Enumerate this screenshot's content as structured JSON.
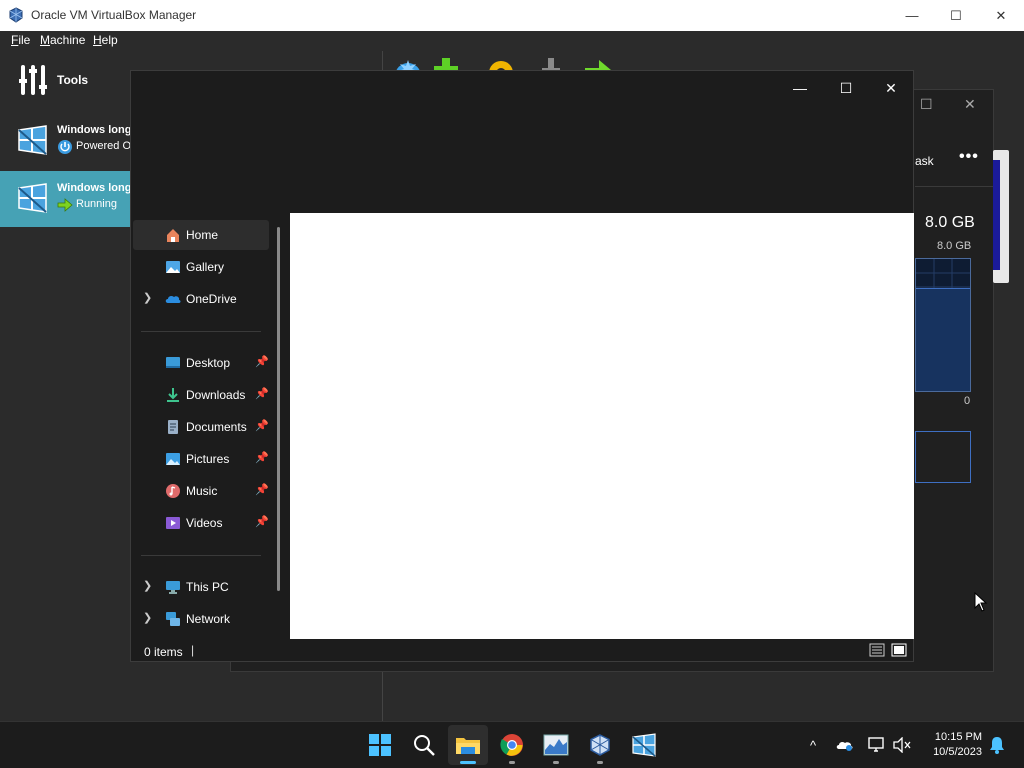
{
  "vbox": {
    "title": "Oracle VM VirtualBox Manager",
    "menu": [
      "File",
      "Machine",
      "Help"
    ],
    "tools_label": "Tools",
    "vms": [
      {
        "name": "Windows long",
        "state": "Powered O",
        "selected": false
      },
      {
        "name": "Windows long",
        "state": "Running",
        "selected": true
      }
    ]
  },
  "taskmgr": {
    "task_label": "ask",
    "more_label": "•••",
    "memory_total": "8.0 GB",
    "memory_axis_max": "8.0 GB",
    "memory_axis_min": "0",
    "memory_used_fraction": 0.78
  },
  "explorer": {
    "nav": {
      "home": "Home",
      "gallery": "Gallery",
      "onedrive": "OneDrive",
      "desktop": "Desktop",
      "downloads": "Downloads",
      "documents": "Documents",
      "pictures": "Pictures",
      "music": "Music",
      "videos": "Videos",
      "this_pc": "This PC",
      "network": "Network"
    },
    "status_items": "0 items"
  },
  "taskbar": {
    "time": "10:15 PM",
    "date": "10/5/2023",
    "apps": [
      "start-icon",
      "search-icon",
      "file-explorer-icon",
      "chrome-icon",
      "task-manager-icon",
      "virtualbox-icon",
      "vm-window-icon"
    ]
  }
}
